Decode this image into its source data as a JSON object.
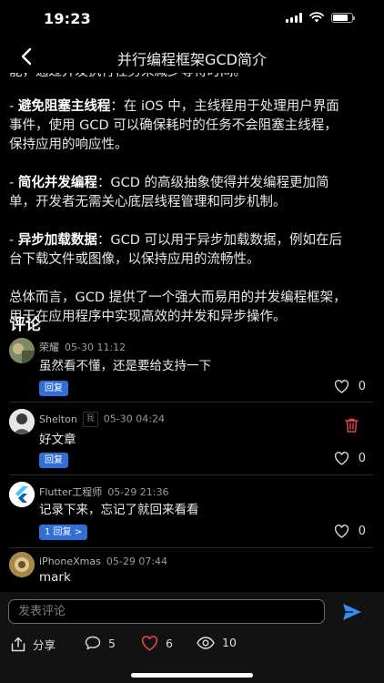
{
  "status": {
    "time": "19:23"
  },
  "nav": {
    "title": "并行编程框架GCD简介"
  },
  "article": {
    "top_fragment": "能，通过并发执行任务来减少等待时间。",
    "bullets": [
      {
        "title": "避免阻塞主线程",
        "line1": "：在 iOS 中，主线程用于处理用户界面",
        "line2": "事件，使用 GCD 可以确保耗时的任务不会阻塞主线程，",
        "line3": "保持应用的响应性。"
      },
      {
        "title": "简化并发编程",
        "line1": "：GCD 的高级抽象使得并发编程更加简",
        "line2": "单，开发者无需关心底层线程管理和同步机制。"
      },
      {
        "title": "异步加载数据",
        "line1": "：GCD 可以用于异步加载数据，例如在后",
        "line2": "台下载文件或图像，以保持应用的流畅性。"
      }
    ],
    "summary_line1": "总体而言，GCD 提供了一个强大而易用的并发编程框架，",
    "summary_line2": "用于在应用程序中实现高效的并发和异步操作。"
  },
  "comments": {
    "heading": "评论",
    "items": [
      {
        "author": "荣耀",
        "time": "05-30 11:12",
        "text": "虽然看不懂，还是要给支持一下",
        "reply_label": "回复",
        "likes": "0"
      },
      {
        "author": "Shelton",
        "self_tag": "我",
        "time": "05-30 04:24",
        "text": "好文章",
        "reply_label": "回复",
        "likes": "0"
      },
      {
        "author": "Flutter工程师",
        "time": "05-29 21:36",
        "text": "记录下来，忘记了就回来看看",
        "reply_label": "1 回复 >",
        "likes": "0"
      },
      {
        "author": "iPhoneXmas",
        "time": "05-29 07:44",
        "text": "mark"
      }
    ]
  },
  "input": {
    "placeholder": "发表评论"
  },
  "actions": {
    "share": "分享",
    "comments": "5",
    "likes": "6",
    "views": "10"
  },
  "colors": {
    "accent": "#2f6fd6",
    "like_active": "#e5484d",
    "delete": "#e5484d"
  }
}
